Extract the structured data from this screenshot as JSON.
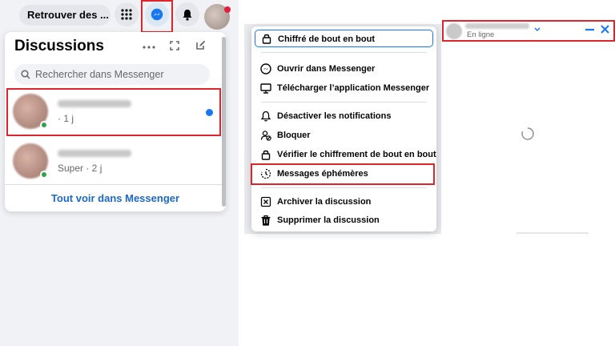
{
  "topbar": {
    "search_pill": "Retrouver des ...",
    "icons": [
      "grid-icon",
      "messenger-icon",
      "bell-icon",
      "avatar"
    ]
  },
  "discussions": {
    "title": "Discussions",
    "search_placeholder": "Rechercher dans Messenger",
    "conversations": [
      {
        "meta": "· 1 j",
        "unread": true
      },
      {
        "meta": "Super · 2 j",
        "unread": false
      }
    ],
    "see_all": "Tout voir dans Messenger"
  },
  "menu": {
    "items": [
      {
        "label": "Chiffré de bout en bout",
        "icon": "lock-icon"
      },
      {
        "label": "Ouvrir dans Messenger",
        "icon": "messenger-icon"
      },
      {
        "label": "Télécharger l’application Messenger",
        "icon": "monitor-icon"
      },
      {
        "label": "Désactiver les notifications",
        "icon": "bell-icon"
      },
      {
        "label": "Bloquer",
        "icon": "block-user-icon"
      },
      {
        "label": "Vérifier le chiffrement de bout en bout",
        "icon": "lock-icon"
      },
      {
        "label": "Messages éphémères",
        "icon": "timer-icon"
      },
      {
        "label": "Archiver la discussion",
        "icon": "archive-icon"
      },
      {
        "label": "Supprimer la discussion",
        "icon": "trash-icon"
      }
    ]
  },
  "chat": {
    "status": "En ligne"
  },
  "colors": {
    "accent": "#1877f2",
    "highlight": "#e0242b",
    "link": "#1b68ca"
  }
}
